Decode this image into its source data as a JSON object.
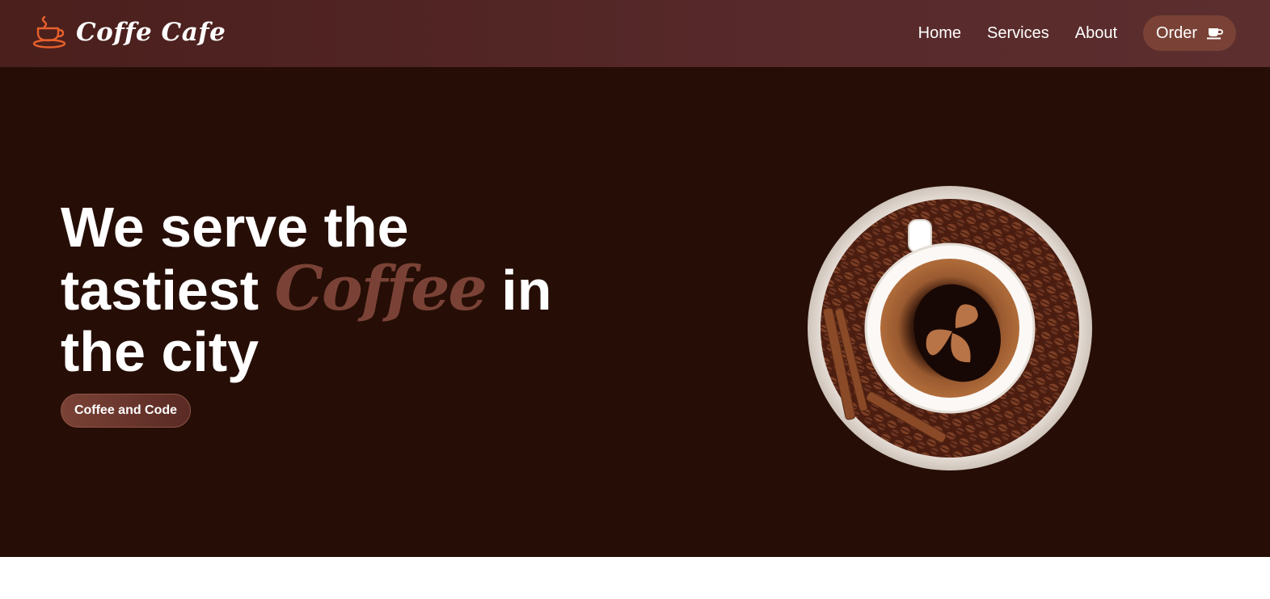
{
  "header": {
    "brand_name": "Coffe Cafe",
    "nav": [
      {
        "label": "Home"
      },
      {
        "label": "Services"
      },
      {
        "label": "About"
      }
    ],
    "order_label": "Order"
  },
  "hero": {
    "headline_line1": "We serve the",
    "headline_line2_pre": "tastiest",
    "headline_accent": "Coffee",
    "headline_line2_post": "in",
    "headline_line3": "the city",
    "cta_label": "Coffee and Code"
  },
  "icons": {
    "brand": "coffee-cup-icon",
    "order": "coffee-cup-icon",
    "hero_image": "coffee-cup-on-beans"
  },
  "colors": {
    "header_bg": "#52262a",
    "hero_bg": "#260e06",
    "accent": "#7a4236",
    "logo_orange": "#e8602c",
    "text": "#ffffff"
  }
}
